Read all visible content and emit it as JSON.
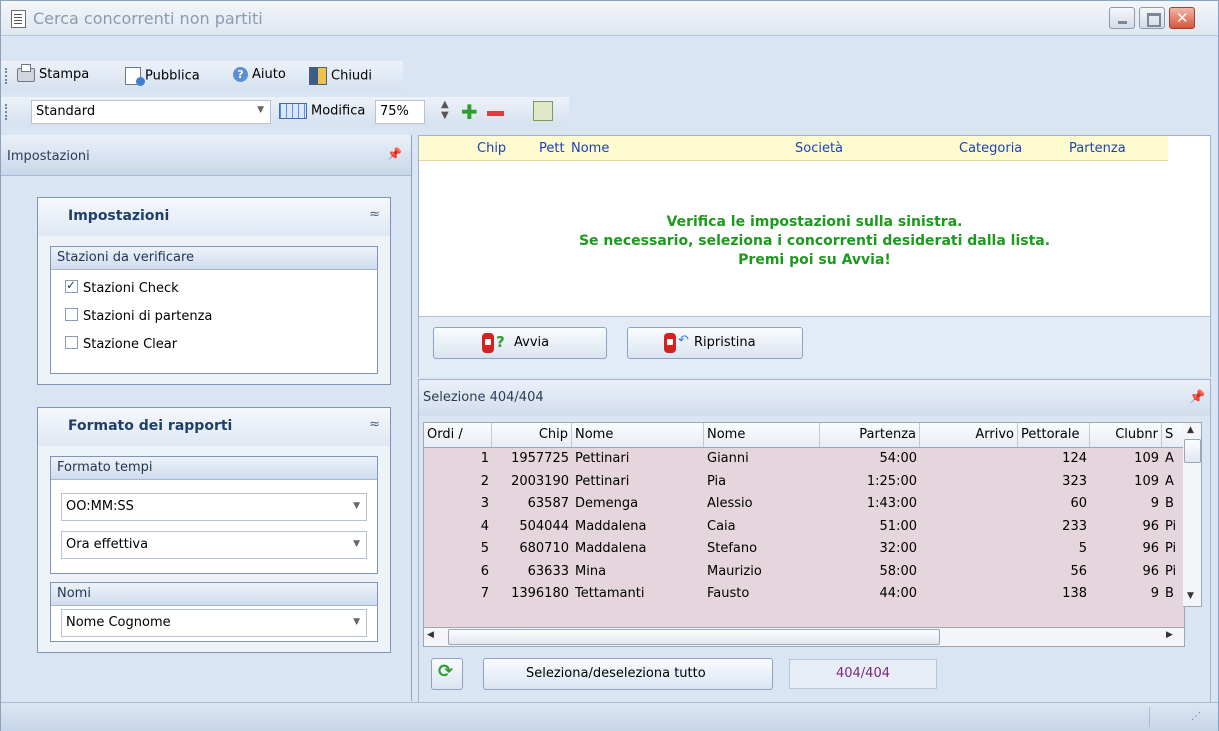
{
  "window": {
    "title": "Cerca concorrenti non partiti"
  },
  "toolbar": {
    "print_label": "Stampa",
    "publish_label": "Pubblica",
    "help_label": "Aiuto",
    "close_label": "Chiudi",
    "layout_value": "Standard",
    "edit_label": "Modifica",
    "zoom_value": "75%"
  },
  "left_panel": {
    "title": "Impostazioni",
    "settings_group": {
      "title": "Impostazioni",
      "stations_header": "Stazioni da verificare",
      "checkboxes": [
        {
          "label": "Stazioni Check",
          "checked": true
        },
        {
          "label": "Stazioni di partenza",
          "checked": false
        },
        {
          "label": "Stazione Clear",
          "checked": false
        }
      ]
    },
    "report_group": {
      "title": "Formato dei rapporti",
      "time_format_header": "Formato tempi",
      "time_format_value": "OO:MM:SS",
      "time_mode_value": "Ora effettiva",
      "names_header": "Nomi",
      "names_value": "Nome Cognome"
    }
  },
  "result_list": {
    "columns": [
      "Chip",
      "Pett",
      "Nome",
      "Società",
      "Categoria",
      "Partenza"
    ],
    "message_lines": [
      "Verifica le impostazioni sulla sinistra.",
      "Se necessario, seleziona i concorrenti desiderati dalla lista.",
      "Premi poi su Avvia!"
    ],
    "start_button": "Avvia",
    "reset_button": "Ripristina"
  },
  "selection": {
    "title": "Selezione  404/404",
    "columns": [
      "Ordi /",
      "Chip",
      "Nome",
      "Nome",
      "Partenza",
      "Arrivo",
      "Pettorale",
      "Clubnr",
      "S"
    ],
    "rows": [
      [
        "1",
        "1957725",
        "Pettinari",
        "Gianni",
        "54:00",
        "",
        "124",
        "109",
        "A"
      ],
      [
        "2",
        "2003190",
        "Pettinari",
        "Pia",
        "1:25:00",
        "",
        "323",
        "109",
        "A"
      ],
      [
        "3",
        "63587",
        "Demenga",
        "Alessio",
        "1:43:00",
        "",
        "60",
        "9",
        "B"
      ],
      [
        "4",
        "504044",
        "Maddalena",
        "Caia",
        "51:00",
        "",
        "233",
        "96",
        "Pi"
      ],
      [
        "5",
        "680710",
        "Maddalena",
        "Stefano",
        "32:00",
        "",
        "5",
        "96",
        "Pi"
      ],
      [
        "6",
        "63633",
        "Mina",
        "Maurizio",
        "58:00",
        "",
        "56",
        "96",
        "Pi"
      ],
      [
        "7",
        "1396180",
        "Tettamanti",
        "Fausto",
        "44:00",
        "",
        "138",
        "9",
        "B"
      ]
    ],
    "toggle_all_button": "Seleziona/deseleziona tutto",
    "count": "404/404"
  },
  "colors": {
    "accent": "#1d9a1d",
    "header_text": "#1e40b8",
    "count_text": "#7a2a7a"
  }
}
